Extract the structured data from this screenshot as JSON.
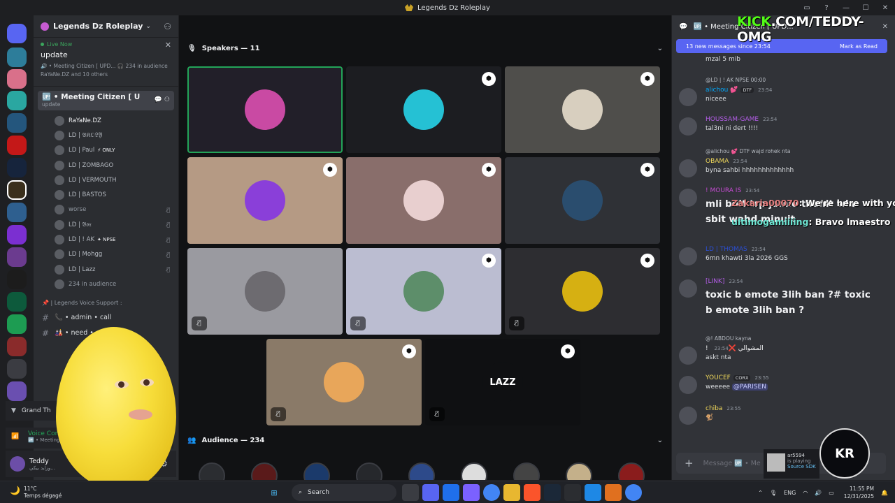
{
  "window": {
    "title": "Legends Dz Roleplay"
  },
  "server": {
    "name": "Legends Dz Roleplay"
  },
  "live": {
    "tag": "Live Now",
    "title": "update",
    "info": "🔊 • Meeting Citizen [ UPD...  🎧 234 in audience",
    "participants": "RaYaNe.DZ and 10 others"
  },
  "active_channel": {
    "name": "🆙 • Meeting Citizen [ UPD...",
    "sub": "update"
  },
  "members": [
    {
      "name": "RaYaNe.DZ",
      "muted": false,
      "color": "#f2f3f5",
      "badge": ""
    },
    {
      "name": "LD | 𝔅𝔎𝔒𝔏𝔜",
      "muted": false,
      "color": "#b5bac1",
      "badge": ""
    },
    {
      "name": "LD | Paul",
      "muted": false,
      "color": "#b5bac1",
      "badge": "⚡ ONLY"
    },
    {
      "name": "LD | ZOMBAGO",
      "muted": false,
      "color": "#b5bac1",
      "badge": ""
    },
    {
      "name": "LD | VERMOUTH",
      "muted": false,
      "color": "#b5bac1",
      "badge": ""
    },
    {
      "name": "LD | BASTOS",
      "muted": false,
      "color": "#b5bac1",
      "badge": ""
    },
    {
      "name": "worse",
      "muted": true,
      "color": "#949ba4",
      "badge": ""
    },
    {
      "name": "LD | 𝔅𝔬𝔵",
      "muted": true,
      "color": "#b5bac1",
      "badge": ""
    },
    {
      "name": "LD | ! AK",
      "muted": true,
      "color": "#b5bac1",
      "badge": "✦ NPSE"
    },
    {
      "name": "LD | Mohgg",
      "muted": true,
      "color": "#b5bac1",
      "badge": ""
    },
    {
      "name": "LD | Lazz",
      "muted": true,
      "color": "#b5bac1",
      "badge": ""
    },
    {
      "name": "234 in audience",
      "muted": false,
      "color": "#949ba4",
      "badge": ""
    }
  ],
  "category": {
    "label": "📌 | Legends Voice Support :"
  },
  "text_channels": [
    {
      "label": "📞 • admin • call"
    },
    {
      "label": "🎎 • need •"
    }
  ],
  "activity": {
    "game": "Grand Th",
    "voice": "Voice Con",
    "voice_sub": "🆙 • Meeting"
  },
  "user": {
    "name": "Teddy",
    "status": "وزايد بيكي..."
  },
  "stage": {
    "speakers_label": "Speakers — 11",
    "audience_label": "Audience — 234"
  },
  "tiles": [
    {
      "bg": "#221f29",
      "av": "#c94aa3",
      "shield": false,
      "muted": false,
      "speaking": true,
      "label": ""
    },
    {
      "bg": "#1c1d21",
      "av": "#25c1d4",
      "shield": true,
      "muted": false,
      "speaking": false,
      "label": ""
    },
    {
      "bg": "#4f4e4b",
      "av": "#d8cfbf",
      "shield": true,
      "muted": false,
      "speaking": false,
      "label": ""
    },
    {
      "bg": "#b59a84",
      "av": "#8a3fd9",
      "shield": true,
      "muted": false,
      "speaking": false,
      "label": ""
    },
    {
      "bg": "#896e6b",
      "av": "#e8cfcf",
      "shield": true,
      "muted": false,
      "speaking": false,
      "label": ""
    },
    {
      "bg": "#2f3136",
      "av": "#2a4d6e",
      "shield": true,
      "muted": false,
      "speaking": false,
      "label": ""
    },
    {
      "bg": "#9a9aa0",
      "av": "#6d6b70",
      "shield": false,
      "muted": true,
      "speaking": false,
      "label": ""
    },
    {
      "bg": "#bbbdd1",
      "av": "#5d8e6a",
      "shield": true,
      "muted": true,
      "speaking": false,
      "label": ""
    },
    {
      "bg": "#2d2d31",
      "av": "#d6b012",
      "shield": true,
      "muted": true,
      "speaking": false,
      "label": ""
    },
    {
      "bg": "#8a7a68",
      "av": "#e8a65a",
      "shield": true,
      "muted": true,
      "speaking": false,
      "label": ""
    },
    {
      "bg": "#0f1012",
      "av": "#0f1012",
      "shield": true,
      "muted": true,
      "speaking": false,
      "label": "LAZZ"
    }
  ],
  "chat": {
    "channel": "🆙 • Meeting Citizen [ UPD...",
    "new_messages": "13 new messages since 23:54",
    "mark_read": "Mark as Read",
    "input_placeholder": "Message 🆙 • Me",
    "messages": [
      {
        "user": "",
        "color": "#dbdee1",
        "time": "",
        "tag": "",
        "reply": "",
        "body": "mzal 5 mib",
        "big": false
      },
      {
        "user": "alichou 💕",
        "color": "#00a8fc",
        "time": "23:54",
        "tag": "DTF",
        "reply": "@LD | ! AK  NPSE  00:00",
        "body": "niceee",
        "big": false
      },
      {
        "user": "HOUSSAM-GAME",
        "color": "#b45de8",
        "time": "23:54",
        "tag": "",
        "reply": "",
        "body": "tal3ni ni dert !!!!",
        "big": false
      },
      {
        "user": "OBAMA",
        "color": "#f0d85a",
        "time": "23:54",
        "tag": "",
        "reply": "@alichou 💕 DTF  wajd rohek nta",
        "body": "byna sahbi hhhhhhhhhhhhh",
        "big": false
      },
      {
        "user": "! MOURA IS",
        "color": "#c44bd1",
        "time": "23:54",
        "tag": "",
        "reply": "",
        "body": "mli bdit trp jamie tbanit wla sbit wahd minuit",
        "big": true
      },
      {
        "user": "LD | THOMAS",
        "color": "#2b4fd6",
        "time": "23:54",
        "tag": "",
        "reply": "",
        "body": "6mn khawti 3la 2026 GGS",
        "big": false
      },
      {
        "user": "[LINK]",
        "color": "#b45de8",
        "time": "23:54",
        "tag": "",
        "reply": "",
        "body": "toxic b emote 3lih ban ?# toxic b emote 3lih ban ?",
        "big": true
      },
      {
        "user": "! المشوالي ❌",
        "color": "#f2f3f5",
        "time": "23:54",
        "tag": "",
        "reply": "@! ABDOU  kayna",
        "body": "askt nta",
        "big": false
      },
      {
        "user": "YOUCEF",
        "color": "#f0d85a",
        "time": "23:55",
        "tag": "CORX",
        "reply": "",
        "body": "weeeee @PARISEN",
        "big": false
      },
      {
        "user": "chiba",
        "color": "#f0d85a",
        "time": "23:55",
        "tag": "",
        "reply": "",
        "body": "🐒",
        "big": false
      }
    ]
  },
  "overlay": {
    "kick_k": "KICK",
    "kick_url": ".COM/TEDDY-OMG",
    "chat_lines": [
      {
        "user": "Zakaria00070",
        "user_color": "#e07b7b",
        "text": ": We're here with you"
      },
      {
        "user": "ultimogamiiiing",
        "user_color": "#6ee7d4",
        "text": ": Bravo lmaestro"
      }
    ],
    "steam": {
      "user": "ar5594",
      "status": "is playing",
      "game": "Source SDK"
    },
    "logo": "KR"
  },
  "taskbar": {
    "temp": "11°C",
    "weather": "Temps dégagé",
    "search": "Search",
    "lang": "ENG",
    "time": "11:55 PM",
    "date": "12/31/2025"
  }
}
